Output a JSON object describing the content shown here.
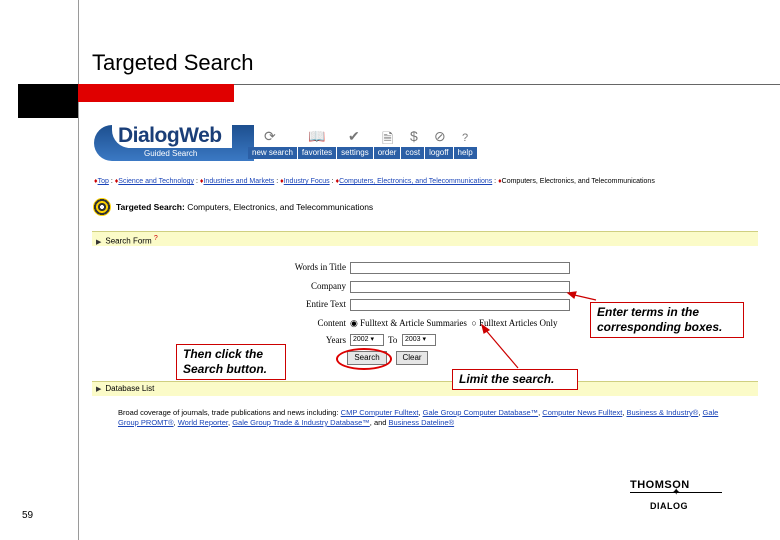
{
  "slide": {
    "title": "Targeted Search",
    "page_number": "59"
  },
  "app": {
    "logo": "DialogWeb",
    "subtitle": "Guided Search",
    "toolbar": [
      "new search",
      "favorites",
      "settings",
      "order",
      "cost",
      "logoff",
      "help"
    ],
    "icons": [
      "refresh-icon",
      "book-icon",
      "check-icon",
      "document-icon",
      "dollar-icon",
      "no-icon",
      "help-icon"
    ]
  },
  "breadcrumb": {
    "items": [
      "Top",
      "Science and Technology",
      "Industries and Markets",
      "Industry Focus",
      "Computers, Electronics, and Telecommunications"
    ],
    "current": "Computers, Electronics, and Telecommunications"
  },
  "targeted": {
    "label": "Targeted Search:",
    "topic": "Computers, Electronics, and Telecommunications"
  },
  "search_form": {
    "label": "Search Form",
    "help": "?"
  },
  "fields": [
    {
      "label": "Words in Title",
      "value": ""
    },
    {
      "label": "Company",
      "value": ""
    },
    {
      "label": "Entire Text",
      "value": ""
    }
  ],
  "content": {
    "label": "Content",
    "options": [
      "Fulltext & Article Summaries",
      "Fulltext Articles Only"
    ],
    "selected": "Fulltext & Article Summaries"
  },
  "years": {
    "label": "Years",
    "from": "2002",
    "to_label": "To",
    "to": "2003"
  },
  "buttons": {
    "search": "Search",
    "clear": "Clear"
  },
  "database_list": {
    "label": "Database List",
    "intro": "Broad coverage of journals, trade publications and news including:",
    "links": [
      "CMP Computer Fulltext",
      "Gale Group Computer Database™",
      "Computer News Fulltext",
      "Business & Industry®",
      "Gale Group PROMT®",
      "World Reporter",
      "Gale Group Trade & Industry Database™",
      "Business Dateline®"
    ]
  },
  "callouts": {
    "enter_terms": "Enter terms in the corresponding boxes.",
    "then_click": "Then click the Search button.",
    "limit": "Limit the search."
  },
  "brand": {
    "line1": "THOMSON",
    "line2": "DIALOG"
  },
  "colors": {
    "accent_red": "#e00000",
    "link_blue": "#1a44b8",
    "toolbar_blue": "#2b5fa6",
    "bar_yellow": "#fbfbc8"
  }
}
